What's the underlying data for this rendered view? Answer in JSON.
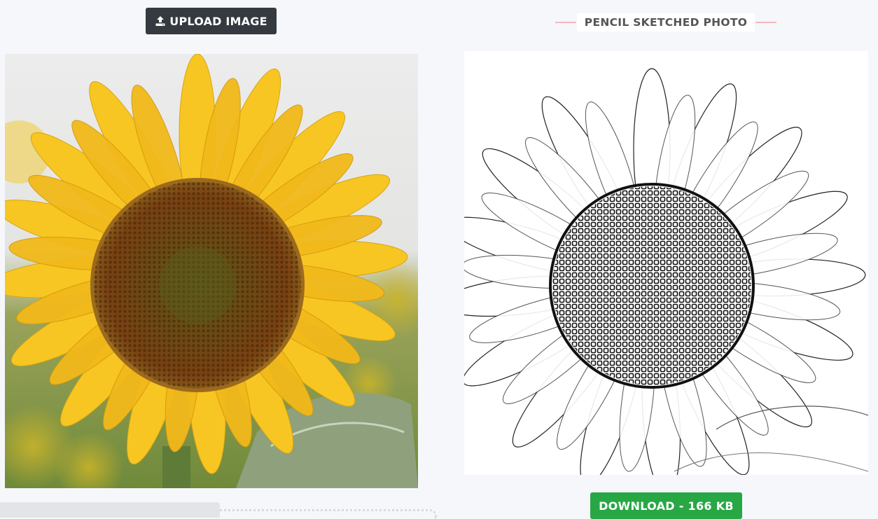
{
  "toolbar": {
    "upload_label": "UPLOAD IMAGE",
    "upload_icon": "upload-icon"
  },
  "result": {
    "heading": "PENCIL SKETCHED PHOTO",
    "download_label": "DOWNLOAD - 166 KB"
  },
  "colors": {
    "upload_button": "#343a40",
    "download_button": "#28a745",
    "heading_line": "#f2b8bf",
    "page_background": "#f6f7fb",
    "petal_yellow": "#f7c623",
    "disk_brown": "#6b3f12"
  }
}
